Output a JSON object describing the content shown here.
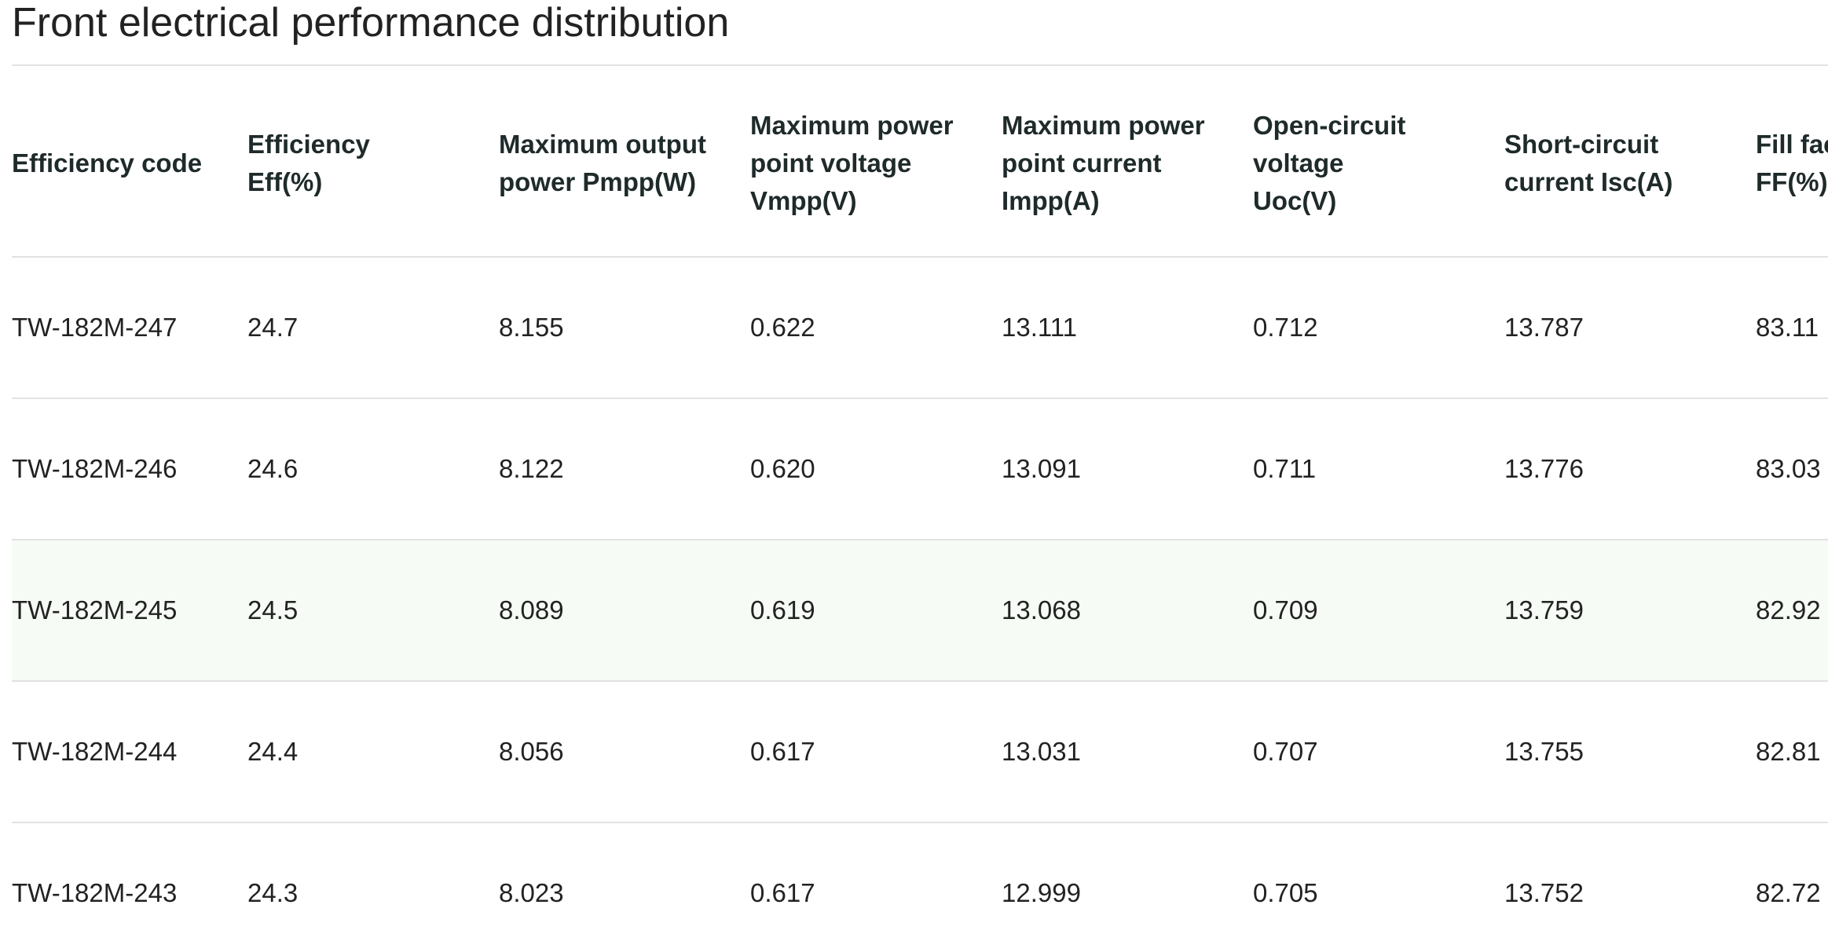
{
  "page": {
    "title": "Front electrical performance distribution"
  },
  "table": {
    "headers": [
      "Efficiency code",
      "Efficiency Eff(%)",
      "Maximum output power Pmpp(W)",
      "Maximum power point voltage Vmpp(V)",
      "Maximum power point current Impp(A)",
      "Open-circuit voltage Uoc(V)",
      "Short-circuit current Isc(A)",
      "Fill factor FF(%)"
    ],
    "rows": [
      [
        "TW-182M-247",
        "24.7",
        "8.155",
        "0.622",
        "13.111",
        "0.712",
        "13.787",
        "83.11"
      ],
      [
        "TW-182M-246",
        "24.6",
        "8.122",
        "0.620",
        "13.091",
        "0.711",
        "13.776",
        "83.03"
      ],
      [
        "TW-182M-245",
        "24.5",
        "8.089",
        "0.619",
        "13.068",
        "0.709",
        "13.759",
        "82.92"
      ],
      [
        "TW-182M-244",
        "24.4",
        "8.056",
        "0.617",
        "13.031",
        "0.707",
        "13.755",
        "82.81"
      ],
      [
        "TW-182M-243",
        "24.3",
        "8.023",
        "0.617",
        "12.999",
        "0.705",
        "13.752",
        "82.72"
      ]
    ],
    "highlighted_row_index": 2
  },
  "colors": {
    "highlight_row_bg": "#f6fbf5",
    "rule": "#e2e2e2",
    "text": "#222222"
  }
}
